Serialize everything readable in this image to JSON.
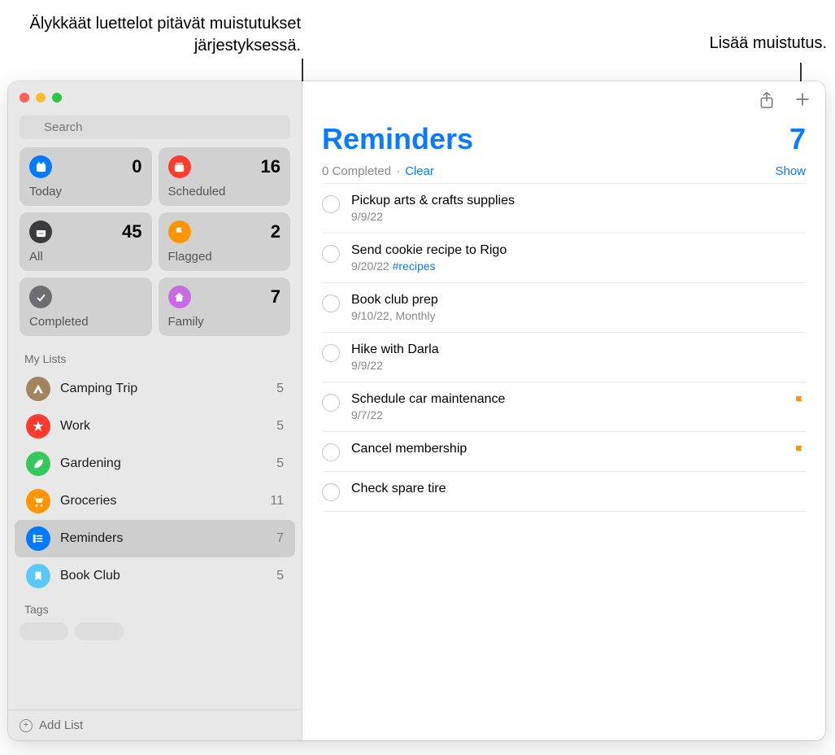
{
  "callouts": {
    "smart_lists": "Älykkäät luettelot pitävät muistutukset järjestyksessä.",
    "add_reminder": "Lisää muistutus."
  },
  "search": {
    "placeholder": "Search"
  },
  "smart_lists": [
    {
      "label": "Today",
      "count": "0",
      "icon": "calendar-icon",
      "bg": "bg-blue"
    },
    {
      "label": "Scheduled",
      "count": "16",
      "icon": "calendar-stack-icon",
      "bg": "bg-red"
    },
    {
      "label": "All",
      "count": "45",
      "icon": "tray-icon",
      "bg": "bg-dark"
    },
    {
      "label": "Flagged",
      "count": "2",
      "icon": "flag-icon",
      "bg": "bg-orange"
    },
    {
      "label": "Completed",
      "count": "",
      "icon": "check-icon",
      "bg": "bg-darkgray"
    },
    {
      "label": "Family",
      "count": "7",
      "icon": "house-icon",
      "bg": "bg-purple"
    }
  ],
  "sections": {
    "my_lists": "My Lists",
    "tags": "Tags"
  },
  "my_lists": [
    {
      "name": "Camping Trip",
      "count": "5",
      "bg": "bg-brown",
      "icon": "tent-icon",
      "selected": false
    },
    {
      "name": "Work",
      "count": "5",
      "bg": "bg-starred",
      "icon": "star-icon",
      "selected": false
    },
    {
      "name": "Gardening",
      "count": "5",
      "bg": "bg-green",
      "icon": "leaf-icon",
      "selected": false
    },
    {
      "name": "Groceries",
      "count": "11",
      "bg": "bg-gorange",
      "icon": "cart-icon",
      "selected": false
    },
    {
      "name": "Reminders",
      "count": "7",
      "bg": "bg-rblue",
      "icon": "list-icon",
      "selected": true
    },
    {
      "name": "Book Club",
      "count": "5",
      "bg": "bg-lblue",
      "icon": "bookmark-icon",
      "selected": false
    }
  ],
  "footer": {
    "add_list": "Add List"
  },
  "main": {
    "title": "Reminders",
    "count": "7",
    "completed_text": "0 Completed",
    "clear": "Clear",
    "show": "Show"
  },
  "reminders": [
    {
      "title": "Pickup arts & crafts supplies",
      "sub": "9/9/22",
      "tag": "",
      "flagged": false
    },
    {
      "title": "Send cookie recipe to Rigo",
      "sub": "9/20/22 ",
      "tag": "#recipes",
      "flagged": false
    },
    {
      "title": "Book club prep",
      "sub": "9/10/22, Monthly",
      "tag": "",
      "flagged": false
    },
    {
      "title": "Hike with Darla",
      "sub": "9/9/22",
      "tag": "",
      "flagged": false
    },
    {
      "title": "Schedule car maintenance",
      "sub": "9/7/22",
      "tag": "",
      "flagged": true
    },
    {
      "title": "Cancel membership",
      "sub": "",
      "tag": "",
      "flagged": true
    },
    {
      "title": "Check spare tire",
      "sub": "",
      "tag": "",
      "flagged": false
    }
  ]
}
